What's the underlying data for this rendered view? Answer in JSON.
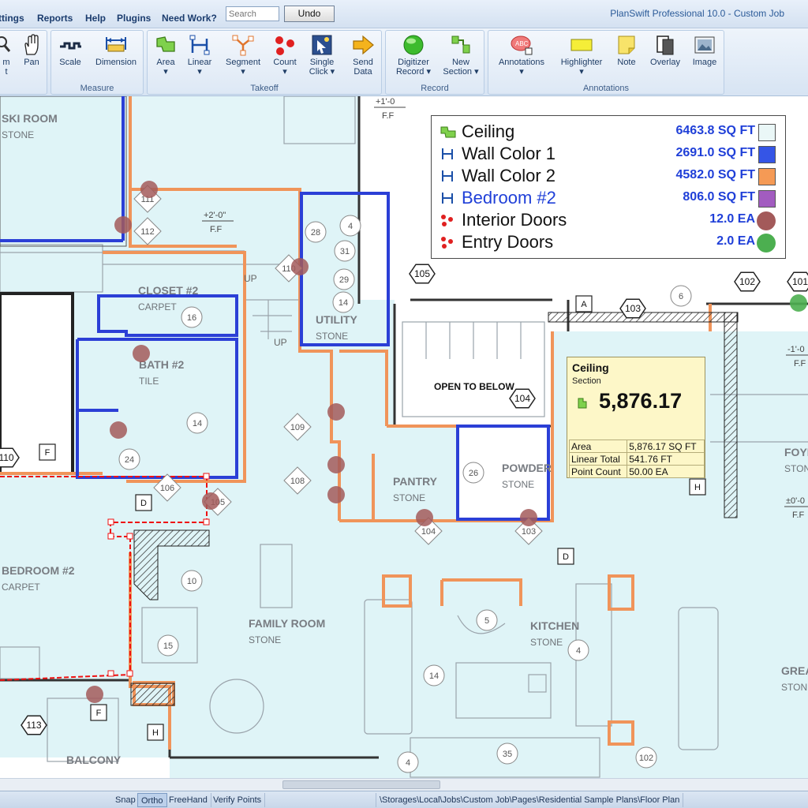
{
  "menu": [
    "ttings",
    "Reports",
    "Help",
    "Plugins",
    "Need Work?"
  ],
  "search": {
    "placeholder": "Search"
  },
  "undo_label": "Undo",
  "app_title": "PlanSwift Professional 10.0 - Custom Job",
  "ribbon": {
    "partial_buttons": [
      {
        "label": "m\nt",
        "icon": "zoom-icon"
      },
      {
        "label": "Pan",
        "icon": "hand-icon"
      }
    ],
    "groups": [
      {
        "label": "Measure",
        "buttons": [
          {
            "label": "Scale",
            "sub": "",
            "icon": "scale-icon"
          },
          {
            "label": "Dimension",
            "sub": "",
            "icon": "dimension-icon"
          }
        ]
      },
      {
        "label": "Takeoff",
        "buttons": [
          {
            "label": "Area",
            "sub": "▾",
            "icon": "area-icon"
          },
          {
            "label": "Linear",
            "sub": "▾",
            "icon": "linear-icon"
          },
          {
            "label": "Segment",
            "sub": "▾",
            "icon": "segment-icon"
          },
          {
            "label": "Count",
            "sub": "▾",
            "icon": "count-icon"
          },
          {
            "label": "Single",
            "sub": "Click ▾",
            "icon": "single-click-icon"
          },
          {
            "label": "Send",
            "sub": "Data",
            "icon": "send-data-icon"
          }
        ]
      },
      {
        "label": "Record",
        "buttons": [
          {
            "label": "Digitizer",
            "sub": "Record ▾",
            "icon": "digitizer-record-icon"
          },
          {
            "label": "New",
            "sub": "Section ▾",
            "icon": "new-section-icon"
          }
        ]
      },
      {
        "label": "Annotations",
        "buttons": [
          {
            "label": "Annotations",
            "sub": "▾",
            "icon": "annotations-icon"
          },
          {
            "label": "Highlighter",
            "sub": "▾",
            "icon": "highlighter-icon"
          },
          {
            "label": "Note",
            "sub": "",
            "icon": "note-icon"
          },
          {
            "label": "Overlay",
            "sub": "",
            "icon": "overlay-icon"
          },
          {
            "label": "Image",
            "sub": "",
            "icon": "image-icon"
          }
        ]
      }
    ]
  },
  "legend": [
    {
      "name": "Ceiling",
      "value": "6463.8 SQ FT",
      "icon": "area-icon",
      "color": "#eaf7f7",
      "kind": "swatch",
      "name_color": "#111111"
    },
    {
      "name": "Wall Color 1",
      "value": "2691.0 SQ FT",
      "icon": "linear-icon",
      "color": "#3555e6",
      "kind": "swatch",
      "name_color": "#111111"
    },
    {
      "name": "Wall Color 2",
      "value": "4582.0 SQ FT",
      "icon": "linear-icon",
      "color": "#f59a55",
      "kind": "swatch",
      "name_color": "#111111"
    },
    {
      "name": "Bedroom #2",
      "value": "806.0 SQ FT",
      "icon": "linear-icon",
      "color": "#a25cc0",
      "kind": "swatch",
      "name_color": "#1f3fd8"
    },
    {
      "name": "Interior Doors",
      "value": "12.0 EA",
      "icon": "count-icon",
      "color": "#a35a5a",
      "kind": "dot",
      "name_color": "#111111"
    },
    {
      "name": "Entry Doors",
      "value": "2.0 EA",
      "icon": "count-icon",
      "color": "#4caf50",
      "kind": "dot",
      "name_color": "#111111"
    }
  ],
  "callout": {
    "title": "Ceiling",
    "subtitle": "Section",
    "big_value": "5,876.17",
    "rows": [
      {
        "label": "Area",
        "value": "5,876.17 SQ FT"
      },
      {
        "label": "Linear Total",
        "value": "541.76 FT"
      },
      {
        "label": "Point Count",
        "value": "50.00 EA"
      }
    ]
  },
  "plan": {
    "rooms": [
      {
        "name": "SKI ROOM",
        "floor": "STONE"
      },
      {
        "name": "CLOSET #2",
        "floor": "CARPET"
      },
      {
        "name": "BATH #2",
        "floor": "TILE"
      },
      {
        "name": "UTILITY",
        "floor": "STONE"
      },
      {
        "name": "PANTRY",
        "floor": "STONE"
      },
      {
        "name": "POWDER",
        "floor": "STONE"
      },
      {
        "name": "BEDROOM #2",
        "floor": "CARPET"
      },
      {
        "name": "FAMILY ROOM",
        "floor": "STONE"
      },
      {
        "name": "KITCHEN",
        "floor": "STONE"
      },
      {
        "name": "FOYE",
        "floor": "STON"
      },
      {
        "name": "GREAT",
        "floor": "STON"
      },
      {
        "name": "BALCONY",
        "floor": ""
      }
    ],
    "labels": {
      "open_to_below": "OPEN TO BELOW",
      "ff1": "+2'-0\"",
      "ff1b": "F.F",
      "ff2": "+1'-0",
      "ff2b": "F.F",
      "ff3": "-1'-0",
      "ff3b": "F.F",
      "ff4": "±0'-0",
      "ff4b": "F.F",
      "up": "UP",
      "up2": "UP"
    },
    "hexagons": [
      "105",
      "102",
      "101",
      "103",
      "104",
      "110",
      "113"
    ],
    "diamonds": [
      "111",
      "112",
      "110",
      "109",
      "108",
      "106",
      "105",
      "104",
      "103"
    ],
    "circles": [
      "28",
      "4",
      "31",
      "29",
      "14",
      "16",
      "14",
      "24",
      "26",
      "10",
      "15",
      "5",
      "4",
      "14",
      "35",
      "4",
      "102",
      "6",
      "1"
    ],
    "square_tags": [
      "F",
      "D",
      "A",
      "H",
      "D",
      "F",
      "H"
    ]
  },
  "statusbar": {
    "items": [
      "Snap",
      "Ortho",
      "FreeHand",
      "Verify Points"
    ],
    "active": "Ortho",
    "path": "\\Storages\\Local\\Jobs\\Custom Job\\Pages\\Residential Sample Plans\\Floor Plan"
  }
}
